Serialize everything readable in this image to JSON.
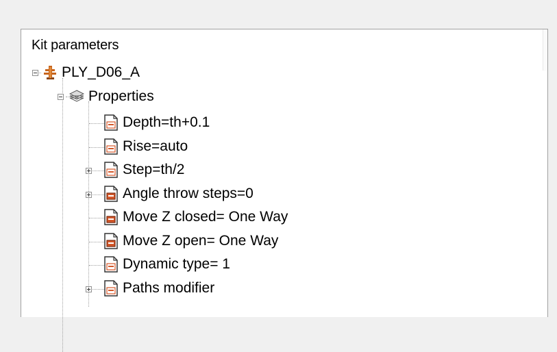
{
  "panel": {
    "title": "Kit parameters"
  },
  "tree": {
    "root": {
      "label": "PLY_D06_A",
      "icon": "kit-icon",
      "expanded": true
    },
    "properties": {
      "label": "Properties",
      "icon": "layers-icon",
      "expanded": true
    },
    "items": [
      {
        "label": "Depth=th+0.1",
        "icon": "document-icon",
        "expander": "none"
      },
      {
        "label": "Rise=auto",
        "icon": "document-icon",
        "expander": "none"
      },
      {
        "label": "Step=th/2",
        "icon": "document-icon",
        "expander": "collapsed"
      },
      {
        "label": "Angle throw steps=0",
        "icon": "document-highlight-icon",
        "expander": "collapsed"
      },
      {
        "label": "Move Z closed= One Way",
        "icon": "document-highlight-icon",
        "expander": "none"
      },
      {
        "label": "Move Z open= One Way",
        "icon": "document-highlight-icon",
        "expander": "none"
      },
      {
        "label": "Dynamic type= 1",
        "icon": "document-icon",
        "expander": "none"
      },
      {
        "label": "Paths modifier",
        "icon": "document-icon",
        "expander": "collapsed"
      }
    ]
  },
  "colors": {
    "background": "#f0f0f0",
    "panel": "#ffffff",
    "tree_lines": "#a0a0a0",
    "icon_accent": "#d4582a"
  }
}
